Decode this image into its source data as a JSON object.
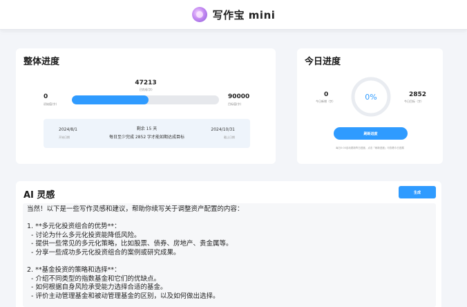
{
  "app": {
    "title": "写作宝 mini"
  },
  "overall": {
    "title": "整体进度",
    "total_value": "47213",
    "total_label": "已完成(字)",
    "left_value": "0",
    "left_label": "初始值(字)",
    "right_value": "90000",
    "right_label": "目标值(字)",
    "progress_fraction": 0.52,
    "start_date": "2024/8/1",
    "start_label": "开始日期",
    "end_date": "2024/10/31",
    "end_label": "截止日期",
    "remaining": "剩余 15 天",
    "daily_goal": "每日至少完成 2852 字才能如期达成目标"
  },
  "today": {
    "title": "今日进度",
    "left_value": "0",
    "left_label": "今日新增（字）",
    "right_value": "2852",
    "right_label": "今日目标（字）",
    "percent": "0%",
    "progress_fraction": 0,
    "refresh_label": "刷新进度",
    "note": "每日0:00自动更新昨日进度，点击「刷新进度」可查看今日进展"
  },
  "ai": {
    "title": "AI 灵感",
    "generate_label": "生成",
    "lines": [
      "当然！以下是一些写作灵感和建议，帮助你续写关于调整资产配置的内容：",
      "",
      "1. **多元化投资组合的优势**：",
      "  - 讨论为什么多元化投资能降低风险。",
      "  - 提供一些常见的多元化策略，比如股票、债券、房地产、贵金属等。",
      "  - 分享一些成功多元化投资组合的案例或研究成果。",
      "",
      "2. **基金投资的策略和选择**：",
      "  - 介绍不同类型的指数基金和它们的优缺点。",
      "  - 如何根据自身风险承受能力选择合适的基金。",
      "  - 评价主动管理基金和被动管理基金的区别，以及如何做出选择。"
    ]
  },
  "colors": {
    "accent": "#2f9bff",
    "track": "#e6e8ec",
    "ring_track": "#e9ecf1"
  },
  "icons": {
    "logo": "app-logo-icon"
  }
}
